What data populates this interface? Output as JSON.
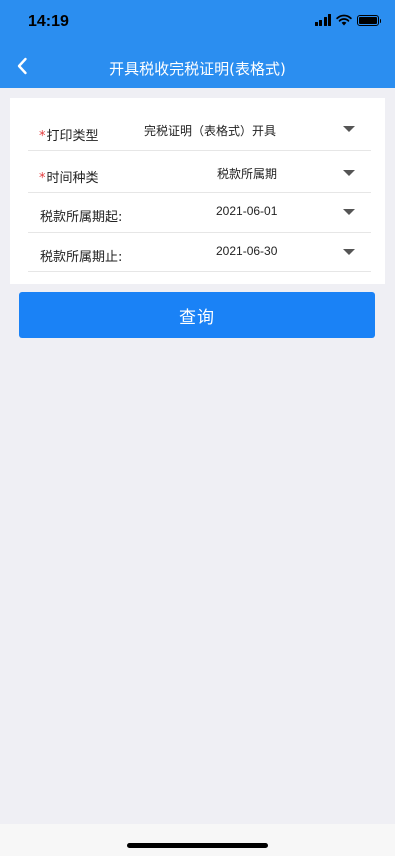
{
  "status_bar": {
    "time": "14:19"
  },
  "nav": {
    "title": "开具税收完税证明(表格式)"
  },
  "form": {
    "rows": [
      {
        "label": "打印类型",
        "required": "*",
        "value": "完税证明（表格式）开具"
      },
      {
        "label": "时间种类",
        "required": "*",
        "value": "税款所属期"
      },
      {
        "label": "税款所属期起:",
        "required": "",
        "value": "2021-06-01"
      },
      {
        "label": "税款所属期止:",
        "required": "",
        "value": "2021-06-30"
      }
    ]
  },
  "actions": {
    "query_label": "查询"
  },
  "colors": {
    "header": "#2b8ef0",
    "button": "#1a82f6",
    "background": "#efeff4",
    "required": "#e4393c"
  },
  "icons": {
    "back": "chevron-left-icon",
    "dropdown": "caret-down-icon",
    "wifi": "wifi-icon",
    "battery": "battery-icon",
    "signal": "cellular-signal-icon"
  }
}
